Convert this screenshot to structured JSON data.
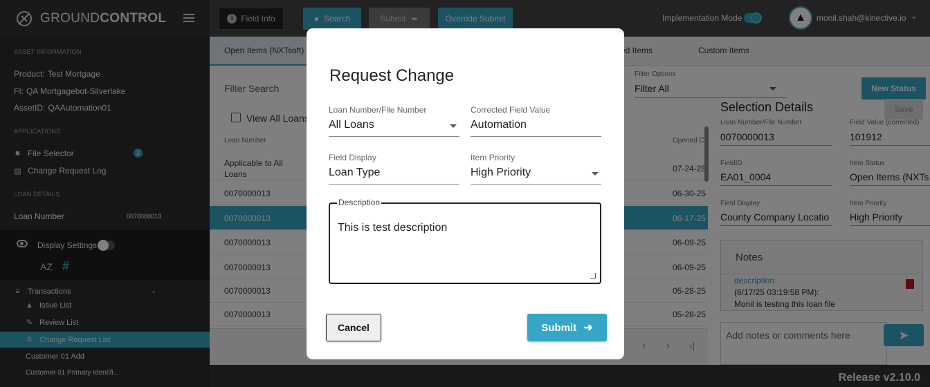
{
  "app": {
    "brand_light": "GROUND",
    "brand_bold": "CONTROL",
    "release": "Release v2.10.0"
  },
  "colors": {
    "accent": "#36a6c7",
    "sidebar": "#2d2d2d",
    "topbar": "#444444",
    "delete": "#cc1111"
  },
  "sidebar": {
    "asset_heading": "ASSET INFORMATION",
    "product_key": "Product:",
    "product_val": "Test Mortgage",
    "fi_key": "FI:",
    "fi_val": "QA Mortgagebot-Silverlake",
    "asset_key": "AssetID:",
    "asset_val": "QAAutomation01",
    "apps_heading": "APPLICATIONS",
    "file_selector": "File Selector",
    "file_selector_badge": "2",
    "change_log": "Change Request Log",
    "loan_heading": "LOAN DETAILS",
    "loan_label": "Loan Number",
    "loan_value": "0070000013",
    "display_settings": "Display Settings",
    "sort_az": "AZ",
    "hash": "#",
    "transactions": "Transactions",
    "issue_list": "Issue List",
    "review_list": "Review List",
    "change_list": "Change Request List",
    "cust_add": "Customer 01 Add",
    "cust_primary": "Customer 01 Primary Identifi..."
  },
  "toolbar": {
    "field_info": "Field Info",
    "search": "Search",
    "submit": "Submit",
    "override": "Override Submit",
    "impl_mode": "Implementation Mode",
    "user": "monil.shah@kinective.io"
  },
  "tabs": {
    "open_items": "Open Items (NXTsoft)",
    "ed_items": "ed Items",
    "custom": "Custom Items"
  },
  "filters": {
    "search_placeholder": "Filter Search",
    "view_all": "View All Loans",
    "options_label": "Filter Options",
    "options_value": "Filter All",
    "new_status": "New Status"
  },
  "table": {
    "col_loan": "Loan Number",
    "col_opened": "Opened C",
    "rows": [
      {
        "loan": "Applicable to All",
        "loan2": "Loans",
        "date": "07-24-25"
      },
      {
        "loan": "0070000013",
        "date": "06-30-25"
      },
      {
        "loan": "0070000013",
        "date": "06-17-25"
      },
      {
        "loan": "0070000013",
        "date": "06-09-25"
      },
      {
        "loan": "0070000013",
        "date": "06-09-25"
      },
      {
        "loan": "0070000013",
        "date": "05-28-25"
      },
      {
        "loan": "0070000013",
        "date": "05-28-25"
      }
    ]
  },
  "details": {
    "title": "Selection Details",
    "save": "Save",
    "loan_lbl": "Loan Number/File Number",
    "loan_val": "0070000013",
    "fv_lbl": "Field Value (corrected)",
    "fv_val": "101912",
    "fid_lbl": "FieldID",
    "fid_val": "EA01_0004",
    "status_lbl": "Item Status",
    "status_val": "Open Items (NXTs",
    "fd_lbl": "Field Display",
    "fd_val": "County Company Locatio",
    "prio_lbl": "Item Priority",
    "prio_val": "High Priority",
    "notes_title": "Notes",
    "note_link": "description",
    "note_time": "(6/17/25 03:19:58 PM):",
    "note_body": "Monil is testing this loan file",
    "add_note_placeholder": "Add notes or comments here"
  },
  "modal": {
    "title": "Request Change",
    "loan_lbl": "Loan Number/File Number",
    "loan_val": "All Loans",
    "corr_lbl": "Corrected Field Value",
    "corr_val": "Automation",
    "fd_lbl": "Field Display",
    "fd_val": "Loan Type",
    "prio_lbl": "Item Priority",
    "prio_val": "High Priority",
    "desc_lbl": "Description",
    "desc_val": "This is test description",
    "cancel": "Cancel",
    "submit": "Submit"
  }
}
